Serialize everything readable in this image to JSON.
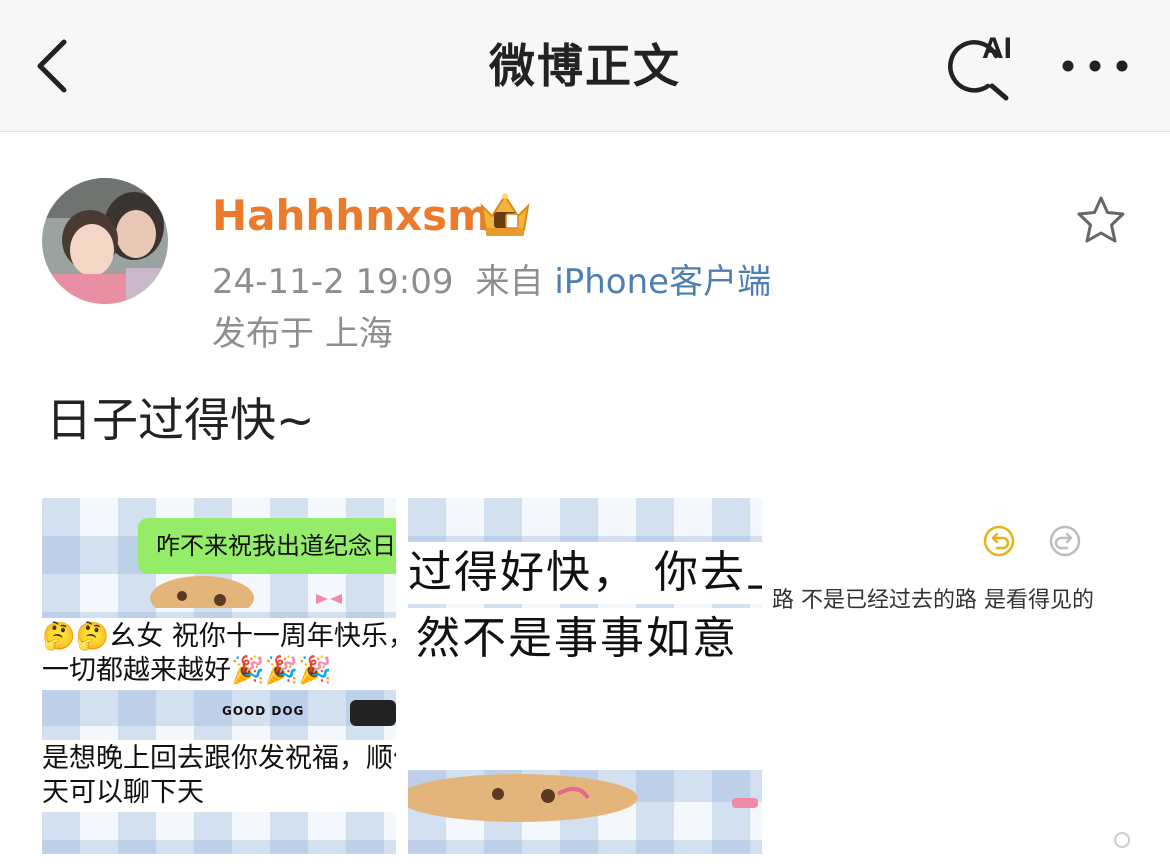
{
  "nav": {
    "title": "微博正文",
    "ai_label": "AI"
  },
  "post": {
    "username": "Hahhhnxsm",
    "date": "24-11-2 19:09",
    "source_prefix": "来自",
    "source": "iPhone客户端",
    "location_prefix": "发布于",
    "location": "上海",
    "text": "日子过得快~"
  },
  "images": [
    {
      "bubble": "咋不来祝我出道纪念日",
      "line1": "🤔🤔幺女 祝你十一周年快乐，",
      "line2": "一切都越来越好🎉🎉🎉",
      "badge": "GOOD DOG",
      "line3": "是想晚上回去跟你发祝福，顺便和",
      "line4": "天可以聊下天"
    },
    {
      "line1": "过得好快， 你去上",
      "line2": "然不是事事如意"
    }
  ],
  "comment_peek": {
    "text": "路 不是已经过去的路 是看得见的"
  },
  "colors": {
    "username": "#eb7b2a",
    "source_link": "#4e7fb2",
    "meta_gray": "#8e8e8e",
    "chat_bubble": "#95ec69",
    "icon_yellow": "#e6b417"
  }
}
